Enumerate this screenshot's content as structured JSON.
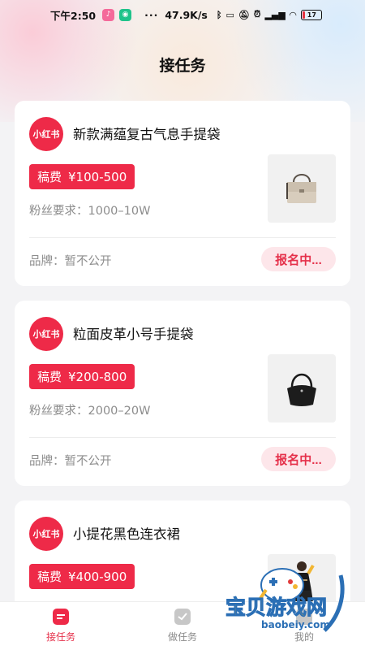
{
  "status_bar": {
    "time": "下午2:50",
    "dots": "···",
    "network_speed": "47.9K/s",
    "battery": "17",
    "battery_level": 0.17
  },
  "header": {
    "title": "接任务"
  },
  "tasks": [
    {
      "platform_logo": "小红书",
      "title": "新款满蕴复古气息手提袋",
      "fee_label": "稿费",
      "fee_range": "¥100-500",
      "requirement": "粉丝要求：1000–10W",
      "brand": "品牌：暂不公开",
      "status_button": "报名中...",
      "thumbnail_icon": "beige-handbag-image"
    },
    {
      "platform_logo": "小红书",
      "title": "粒面皮革小号手提袋",
      "fee_label": "稿费",
      "fee_range": "¥200-800",
      "requirement": "粉丝要求：2000–20W",
      "brand": "品牌：暂不公开",
      "status_button": "报名中...",
      "thumbnail_icon": "black-hobo-bag-image"
    },
    {
      "platform_logo": "小红书",
      "title": "小提花黑色连衣裙",
      "fee_label": "稿费",
      "fee_range": "¥400-900",
      "thumbnail_icon": "black-dress-model-image"
    }
  ],
  "tabbar": {
    "tabs": [
      {
        "label": "接任务",
        "active": true
      },
      {
        "label": "做任务",
        "active": false
      },
      {
        "label": "我的",
        "active": false
      }
    ]
  },
  "watermark": {
    "text": "宝贝游戏网",
    "url": "baobeiy.com"
  },
  "colors": {
    "accent": "#ee2a48",
    "accent_soft": "#fde6ea",
    "muted_text": "#8d8d8d"
  }
}
